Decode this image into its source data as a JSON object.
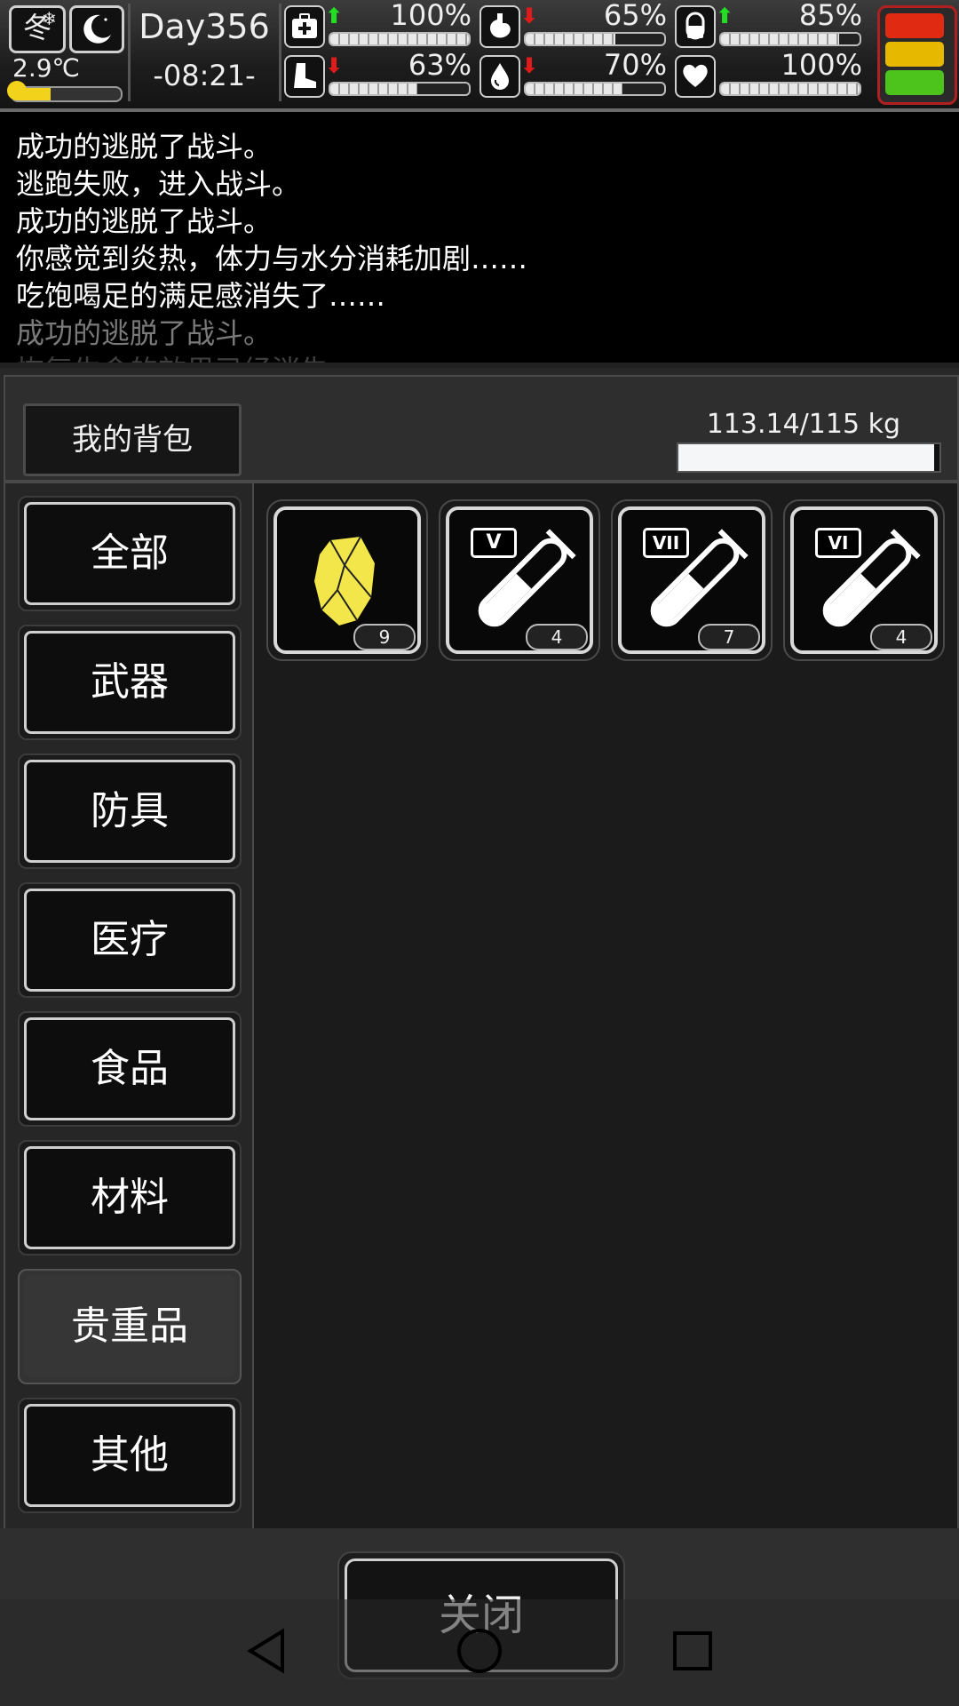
{
  "status": {
    "season": "冬",
    "temperature": "2.9℃",
    "temperature_level": 0.35,
    "day": "Day356",
    "time": "-08:21-",
    "stats": [
      {
        "icon": "medkit-icon",
        "trend": "up",
        "percent": "100%",
        "value": 1.0
      },
      {
        "icon": "stomach-icon",
        "trend": "down",
        "percent": "65%",
        "value": 0.65
      },
      {
        "icon": "pill-icon",
        "trend": "up",
        "percent": "85%",
        "value": 0.85
      },
      {
        "icon": "boot-icon",
        "trend": "down",
        "percent": "63%",
        "value": 0.63
      },
      {
        "icon": "water-drop-icon",
        "trend": "down",
        "percent": "70%",
        "value": 0.7
      },
      {
        "icon": "heart-icon",
        "trend": "none",
        "percent": "100%",
        "value": 1.0
      }
    ],
    "alert_colors": [
      "#e02b12",
      "#e6b800",
      "#4cc41c"
    ]
  },
  "log": {
    "lines": [
      "成功的逃脱了战斗。",
      "逃跑失败，进入战斗。",
      "成功的逃脱了战斗。",
      "你感觉到炎热，体力与水分消耗加剧……",
      "吃饱喝足的满足感消失了……",
      "成功的逃脱了战斗。",
      "恢复生命的效果已经消失"
    ]
  },
  "backpack": {
    "title": "我的背包",
    "weight": "113.14/115 kg",
    "weight_fraction": 0.98,
    "categories": [
      "全部",
      "武器",
      "防具",
      "医疗",
      "食品",
      "材料",
      "贵重品",
      "其他"
    ],
    "active_category": "贵重品",
    "items": [
      {
        "icon": "gold-nugget-icon",
        "count": "9",
        "color": "#f2e64a"
      },
      {
        "icon": "test-tube-icon",
        "label": "V",
        "count": "4"
      },
      {
        "icon": "test-tube-icon",
        "label": "VII",
        "count": "7"
      },
      {
        "icon": "test-tube-icon",
        "label": "VI",
        "count": "4"
      }
    ]
  },
  "close_label": "关闭"
}
